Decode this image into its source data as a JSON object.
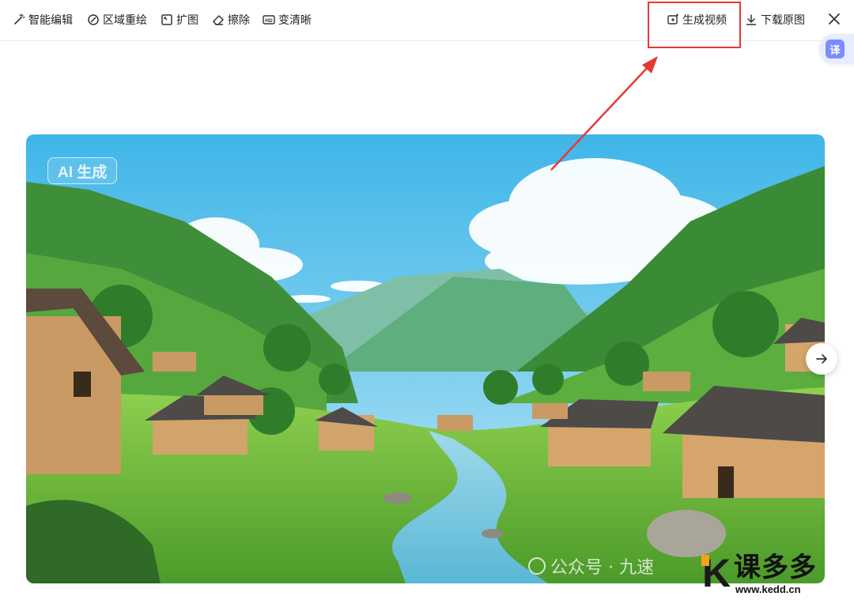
{
  "toolbar": {
    "smart_edit": "智能编辑",
    "region_repaint": "区域重绘",
    "expand": "扩图",
    "erase": "擦除",
    "upscale": "变清晰",
    "generate_video": "生成视频",
    "download": "下载原图"
  },
  "translate": {
    "label": "译"
  },
  "image": {
    "badge": "AI 生成"
  },
  "watermark": {
    "text": "公众号 · 九速"
  },
  "logo": {
    "name": "课多多",
    "url": "www.kedd.cn"
  },
  "colors": {
    "annotation": "#e53935",
    "translate_accent": "#7b8cff"
  }
}
